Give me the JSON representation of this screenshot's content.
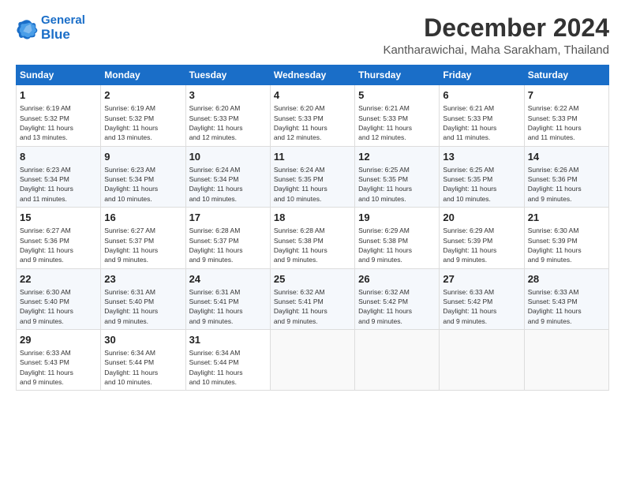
{
  "logo": {
    "line1": "General",
    "line2": "Blue"
  },
  "title": "December 2024",
  "subtitle": "Kantharawichai, Maha Sarakham, Thailand",
  "days_of_week": [
    "Sunday",
    "Monday",
    "Tuesday",
    "Wednesday",
    "Thursday",
    "Friday",
    "Saturday"
  ],
  "weeks": [
    [
      {
        "day": 1,
        "info": "Sunrise: 6:19 AM\nSunset: 5:32 PM\nDaylight: 11 hours\nand 13 minutes."
      },
      {
        "day": 2,
        "info": "Sunrise: 6:19 AM\nSunset: 5:32 PM\nDaylight: 11 hours\nand 13 minutes."
      },
      {
        "day": 3,
        "info": "Sunrise: 6:20 AM\nSunset: 5:33 PM\nDaylight: 11 hours\nand 12 minutes."
      },
      {
        "day": 4,
        "info": "Sunrise: 6:20 AM\nSunset: 5:33 PM\nDaylight: 11 hours\nand 12 minutes."
      },
      {
        "day": 5,
        "info": "Sunrise: 6:21 AM\nSunset: 5:33 PM\nDaylight: 11 hours\nand 12 minutes."
      },
      {
        "day": 6,
        "info": "Sunrise: 6:21 AM\nSunset: 5:33 PM\nDaylight: 11 hours\nand 11 minutes."
      },
      {
        "day": 7,
        "info": "Sunrise: 6:22 AM\nSunset: 5:33 PM\nDaylight: 11 hours\nand 11 minutes."
      }
    ],
    [
      {
        "day": 8,
        "info": "Sunrise: 6:23 AM\nSunset: 5:34 PM\nDaylight: 11 hours\nand 11 minutes."
      },
      {
        "day": 9,
        "info": "Sunrise: 6:23 AM\nSunset: 5:34 PM\nDaylight: 11 hours\nand 10 minutes."
      },
      {
        "day": 10,
        "info": "Sunrise: 6:24 AM\nSunset: 5:34 PM\nDaylight: 11 hours\nand 10 minutes."
      },
      {
        "day": 11,
        "info": "Sunrise: 6:24 AM\nSunset: 5:35 PM\nDaylight: 11 hours\nand 10 minutes."
      },
      {
        "day": 12,
        "info": "Sunrise: 6:25 AM\nSunset: 5:35 PM\nDaylight: 11 hours\nand 10 minutes."
      },
      {
        "day": 13,
        "info": "Sunrise: 6:25 AM\nSunset: 5:35 PM\nDaylight: 11 hours\nand 10 minutes."
      },
      {
        "day": 14,
        "info": "Sunrise: 6:26 AM\nSunset: 5:36 PM\nDaylight: 11 hours\nand 9 minutes."
      }
    ],
    [
      {
        "day": 15,
        "info": "Sunrise: 6:27 AM\nSunset: 5:36 PM\nDaylight: 11 hours\nand 9 minutes."
      },
      {
        "day": 16,
        "info": "Sunrise: 6:27 AM\nSunset: 5:37 PM\nDaylight: 11 hours\nand 9 minutes."
      },
      {
        "day": 17,
        "info": "Sunrise: 6:28 AM\nSunset: 5:37 PM\nDaylight: 11 hours\nand 9 minutes."
      },
      {
        "day": 18,
        "info": "Sunrise: 6:28 AM\nSunset: 5:38 PM\nDaylight: 11 hours\nand 9 minutes."
      },
      {
        "day": 19,
        "info": "Sunrise: 6:29 AM\nSunset: 5:38 PM\nDaylight: 11 hours\nand 9 minutes."
      },
      {
        "day": 20,
        "info": "Sunrise: 6:29 AM\nSunset: 5:39 PM\nDaylight: 11 hours\nand 9 minutes."
      },
      {
        "day": 21,
        "info": "Sunrise: 6:30 AM\nSunset: 5:39 PM\nDaylight: 11 hours\nand 9 minutes."
      }
    ],
    [
      {
        "day": 22,
        "info": "Sunrise: 6:30 AM\nSunset: 5:40 PM\nDaylight: 11 hours\nand 9 minutes."
      },
      {
        "day": 23,
        "info": "Sunrise: 6:31 AM\nSunset: 5:40 PM\nDaylight: 11 hours\nand 9 minutes."
      },
      {
        "day": 24,
        "info": "Sunrise: 6:31 AM\nSunset: 5:41 PM\nDaylight: 11 hours\nand 9 minutes."
      },
      {
        "day": 25,
        "info": "Sunrise: 6:32 AM\nSunset: 5:41 PM\nDaylight: 11 hours\nand 9 minutes."
      },
      {
        "day": 26,
        "info": "Sunrise: 6:32 AM\nSunset: 5:42 PM\nDaylight: 11 hours\nand 9 minutes."
      },
      {
        "day": 27,
        "info": "Sunrise: 6:33 AM\nSunset: 5:42 PM\nDaylight: 11 hours\nand 9 minutes."
      },
      {
        "day": 28,
        "info": "Sunrise: 6:33 AM\nSunset: 5:43 PM\nDaylight: 11 hours\nand 9 minutes."
      }
    ],
    [
      {
        "day": 29,
        "info": "Sunrise: 6:33 AM\nSunset: 5:43 PM\nDaylight: 11 hours\nand 9 minutes."
      },
      {
        "day": 30,
        "info": "Sunrise: 6:34 AM\nSunset: 5:44 PM\nDaylight: 11 hours\nand 10 minutes."
      },
      {
        "day": 31,
        "info": "Sunrise: 6:34 AM\nSunset: 5:44 PM\nDaylight: 11 hours\nand 10 minutes."
      },
      null,
      null,
      null,
      null
    ]
  ]
}
